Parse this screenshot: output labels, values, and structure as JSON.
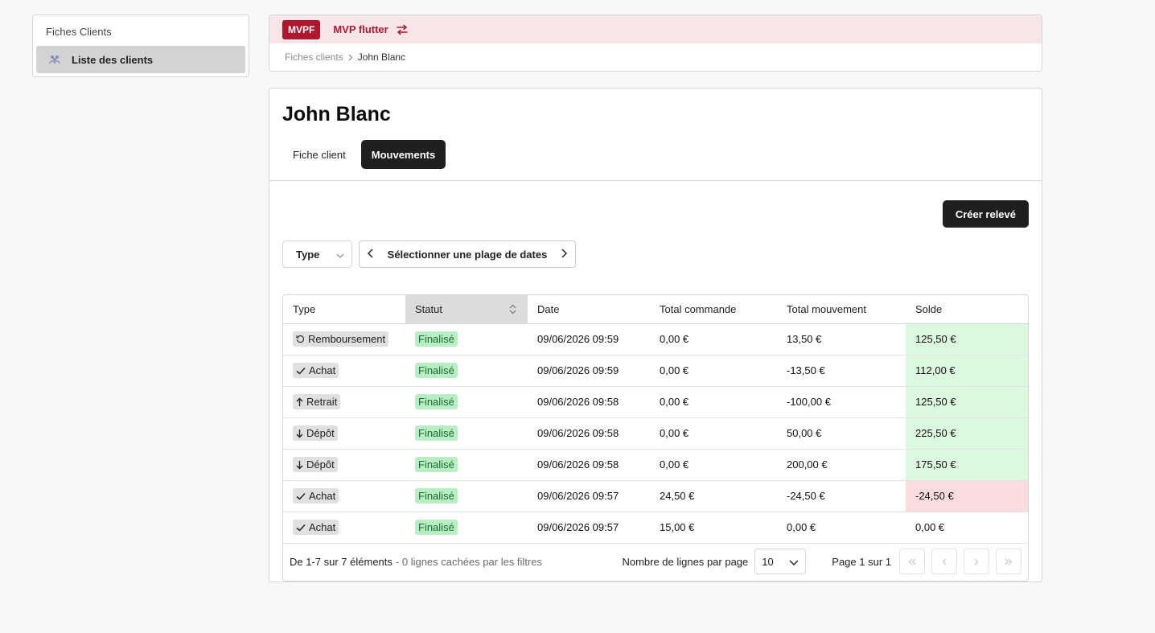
{
  "sidebar": {
    "title": "Fiches Clients",
    "items": [
      {
        "label": "Liste des clients",
        "icon": "users-icon"
      }
    ]
  },
  "header": {
    "app_badge": "MVPF",
    "app_name": "MVP flutter",
    "accent_color": "#b0162d",
    "breadcrumb": {
      "parent": "Fiches clients",
      "current": "John Blanc"
    }
  },
  "main": {
    "title": "John Blanc",
    "tabs": [
      {
        "label": "Fiche client",
        "active": false
      },
      {
        "label": "Mouvements",
        "active": true
      }
    ],
    "create_button": "Créer relevé",
    "filters": {
      "type_label": "Type",
      "date_range_label": "Sélectionner une plage de dates"
    },
    "table": {
      "columns": [
        "Type",
        "Statut",
        "Date",
        "Total commande",
        "Total mouvement",
        "Solde"
      ],
      "sorted_column": "Statut",
      "rows": [
        {
          "type": "Remboursement",
          "type_icon": "refund-icon",
          "status": "Finalisé",
          "date": "09/06/2026 09:59",
          "total_commande": "0,00 €",
          "total_mouvement": "13,50 €",
          "solde": "125,50 €",
          "solde_state": "positive"
        },
        {
          "type": "Achat",
          "type_icon": "check-icon",
          "status": "Finalisé",
          "date": "09/06/2026 09:59",
          "total_commande": "0,00 €",
          "total_mouvement": "-13,50 €",
          "solde": "112,00 €",
          "solde_state": "positive"
        },
        {
          "type": "Retrait",
          "type_icon": "arrow-up-icon",
          "status": "Finalisé",
          "date": "09/06/2026 09:58",
          "total_commande": "0,00 €",
          "total_mouvement": "-100,00 €",
          "solde": "125,50 €",
          "solde_state": "positive"
        },
        {
          "type": "Dépôt",
          "type_icon": "arrow-down-icon",
          "status": "Finalisé",
          "date": "09/06/2026 09:58",
          "total_commande": "0,00 €",
          "total_mouvement": "50,00 €",
          "solde": "225,50 €",
          "solde_state": "positive"
        },
        {
          "type": "Dépôt",
          "type_icon": "arrow-down-icon",
          "status": "Finalisé",
          "date": "09/06/2026 09:58",
          "total_commande": "0,00 €",
          "total_mouvement": "200,00 €",
          "solde": "175,50 €",
          "solde_state": "positive"
        },
        {
          "type": "Achat",
          "type_icon": "check-icon",
          "status": "Finalisé",
          "date": "09/06/2026 09:57",
          "total_commande": "24,50 €",
          "total_mouvement": "-24,50 €",
          "solde": "-24,50 €",
          "solde_state": "negative"
        },
        {
          "type": "Achat",
          "type_icon": "check-icon",
          "status": "Finalisé",
          "date": "09/06/2026 09:57",
          "total_commande": "15,00 €",
          "total_mouvement": "0,00 €",
          "solde": "0,00 €",
          "solde_state": "neutral"
        }
      ]
    },
    "footer": {
      "range": "De 1-7 sur 7 éléments",
      "hidden": "- 0 lignes cachées par les filtres",
      "rows_per_page_label": "Nombre de lignes par page",
      "rows_per_page": "10",
      "page_info": "Page 1 sur 1"
    }
  },
  "colors": {
    "positive_bg": "#dcf8df",
    "negative_bg": "#fbdcdc",
    "status_bg": "#b9eec4"
  }
}
